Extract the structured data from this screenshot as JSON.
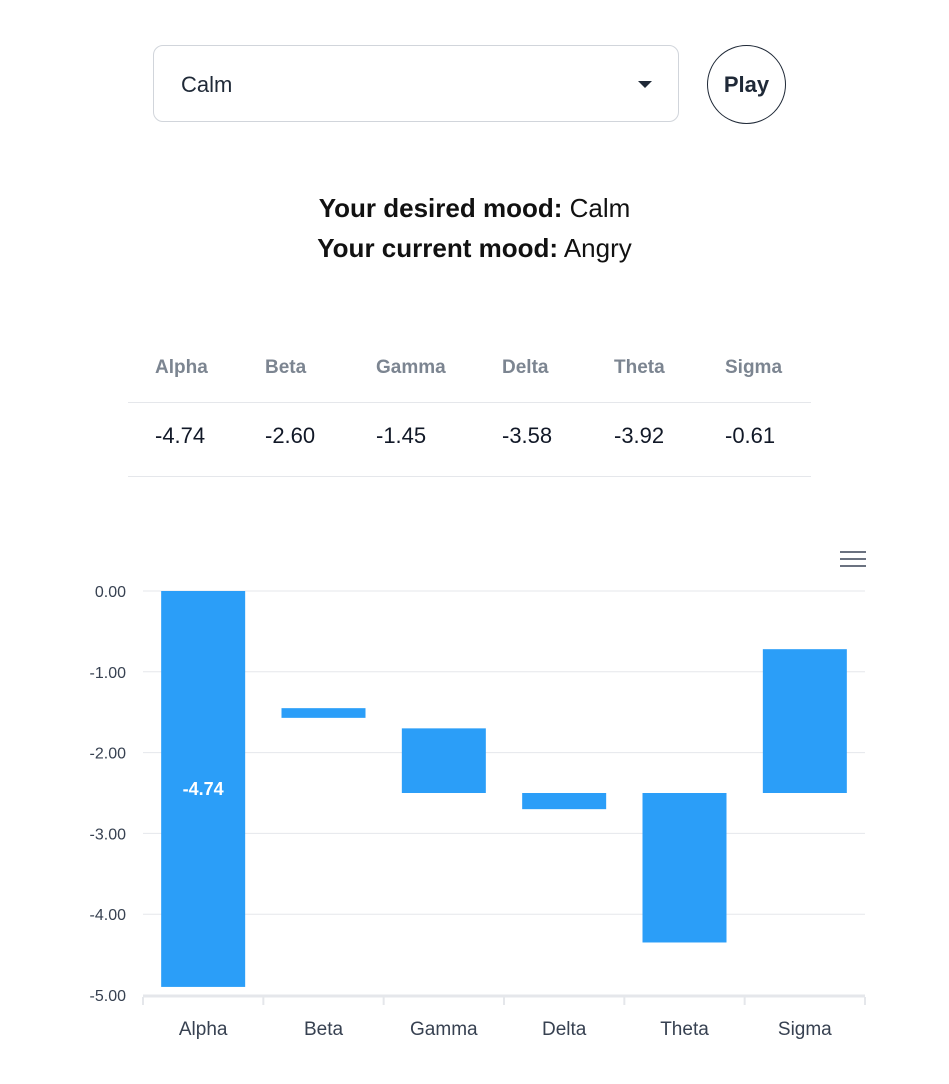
{
  "mood_select": {
    "selected": "Calm"
  },
  "play_button": {
    "label": "Play"
  },
  "mood": {
    "desired_label": "Your desired mood:",
    "desired_value": "Calm",
    "current_label": "Your current mood:",
    "current_value": "Angry"
  },
  "table": {
    "headers": [
      "Alpha",
      "Beta",
      "Gamma",
      "Delta",
      "Theta",
      "Sigma"
    ],
    "values": [
      "-4.74",
      "-2.60",
      "-1.45",
      "-3.58",
      "-3.92",
      "-0.61"
    ]
  },
  "chart_data": {
    "type": "bar",
    "subtype": "waterfall",
    "categories": [
      "Alpha",
      "Beta",
      "Gamma",
      "Delta",
      "Theta",
      "Sigma"
    ],
    "ranges": [
      [
        0,
        -4.9
      ],
      [
        -1.45,
        -1.57
      ],
      [
        -1.7,
        -2.5
      ],
      [
        -2.5,
        -2.7
      ],
      [
        -2.5,
        -4.35
      ],
      [
        -0.72,
        -2.5
      ]
    ],
    "data_labels": [
      "-4.74"
    ],
    "ylim": [
      -5,
      0
    ],
    "yticks": [
      "0.00",
      "-1.00",
      "-2.00",
      "-3.00",
      "-4.00",
      "-5.00"
    ],
    "grid": true,
    "color": "#2b9ef8"
  }
}
